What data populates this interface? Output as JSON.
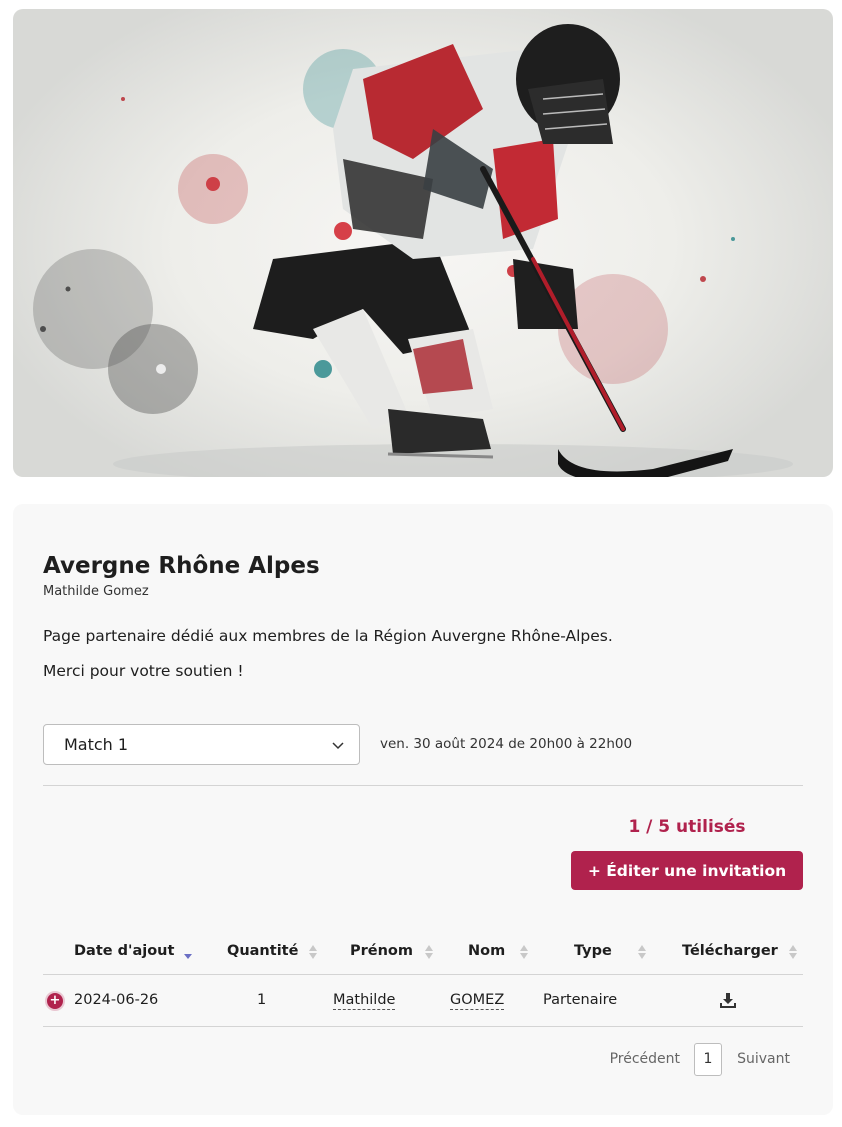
{
  "partner": {
    "name": "Avergne Rhône Alpes",
    "contact": "Mathilde Gomez",
    "description": "Page partenaire dédié aux membres de la Région Auvergne Rhône-Alpes.",
    "thanks": "Merci pour votre soutien !"
  },
  "event": {
    "selected": "Match 1",
    "date": "ven. 30 août 2024 de 20h00 à 22h00"
  },
  "usage": "1 / 5 utilisés",
  "edit_button": "+ Éditer une invitation",
  "table": {
    "headers": [
      "Date d'ajout",
      "Quantité",
      "Prénom",
      "Nom",
      "Type",
      "Télécharger"
    ],
    "rows": [
      {
        "date": "2024-06-26",
        "quantity": "1",
        "first_name": "Mathilde",
        "last_name": "GOMEZ",
        "type": "Partenaire"
      }
    ]
  },
  "pagination": {
    "prev": "Précédent",
    "page": "1",
    "next": "Suivant"
  },
  "colors": {
    "accent": "#b0224d",
    "sort_active": "#6b6fc4",
    "card_bg": "#f8f8f8"
  },
  "icons": [
    "chevron-down-icon",
    "sort-icon",
    "expand-plus-icon",
    "download-icon"
  ]
}
